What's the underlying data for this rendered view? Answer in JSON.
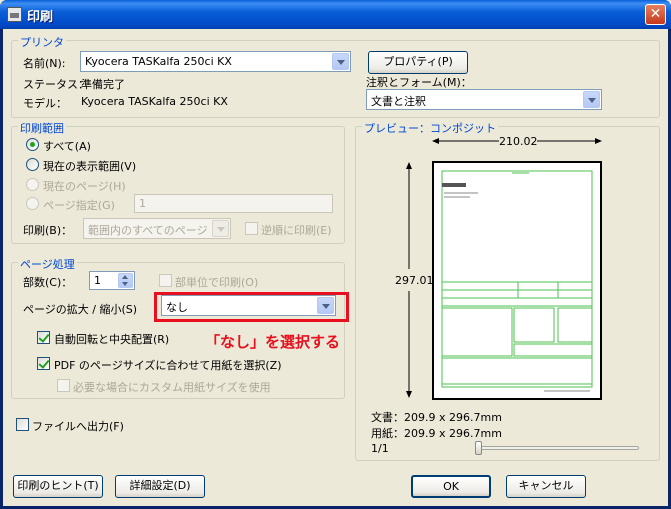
{
  "window": {
    "title": "印刷",
    "close_glyph": "✕"
  },
  "printer": {
    "group_label": "プリンタ",
    "name_label": "名前(N):",
    "name_value": "Kyocera TASKalfa 250ci KX",
    "properties_button": "プロパティ(P)",
    "status_label": "ステータス：",
    "status_value": "準備完了",
    "model_label": "モデル：",
    "model_value": "Kyocera TASKalfa 250ci KX",
    "comments_label": "注釈とフォーム(M)：",
    "comments_value": "文書と注釈"
  },
  "range": {
    "group_label": "印刷範囲",
    "all": "すべて(A)",
    "current_view": "現在の表示範囲(V)",
    "current_page": "現在のページ(H)",
    "pages": "ページ指定(G)",
    "pages_value": "1",
    "subset_label": "印刷(B)：",
    "subset_value": "範囲内のすべてのページ",
    "reverse": "逆順に印刷(E)"
  },
  "handling": {
    "group_label": "ページ処理",
    "copies_label": "部数(C)：",
    "copies_value": "1",
    "collate": "部単位で印刷(O)",
    "scaling_label": "ページの拡大 / 縮小(S)",
    "scaling_value": "なし",
    "auto_rotate": "自動回転と中央配置(R)",
    "pdf_paper": "PDF のページサイズに合わせて用紙を選択(Z)",
    "custom_paper": "必要な場合にカスタム用紙サイズを使用"
  },
  "annotation_note": "「なし」を選択する",
  "print_to_file": "ファイルへ出力(F)",
  "preview": {
    "group_label": "プレビュー：コンポジット",
    "width": "210.02",
    "height": "297.01",
    "document_size": "文書：209.9 x 296.7mm",
    "paper_size": "用紙：209.9 x 296.7mm",
    "page_counter": "1/1"
  },
  "buttons": {
    "tips": "印刷のヒント(T)",
    "advanced": "詳細設定(D)",
    "ok": "OK",
    "cancel": "キャンセル"
  },
  "colors": {
    "accent_red": "#e8101e",
    "preview_green": "#4fc24f",
    "group_label_blue": "#0046d5"
  }
}
